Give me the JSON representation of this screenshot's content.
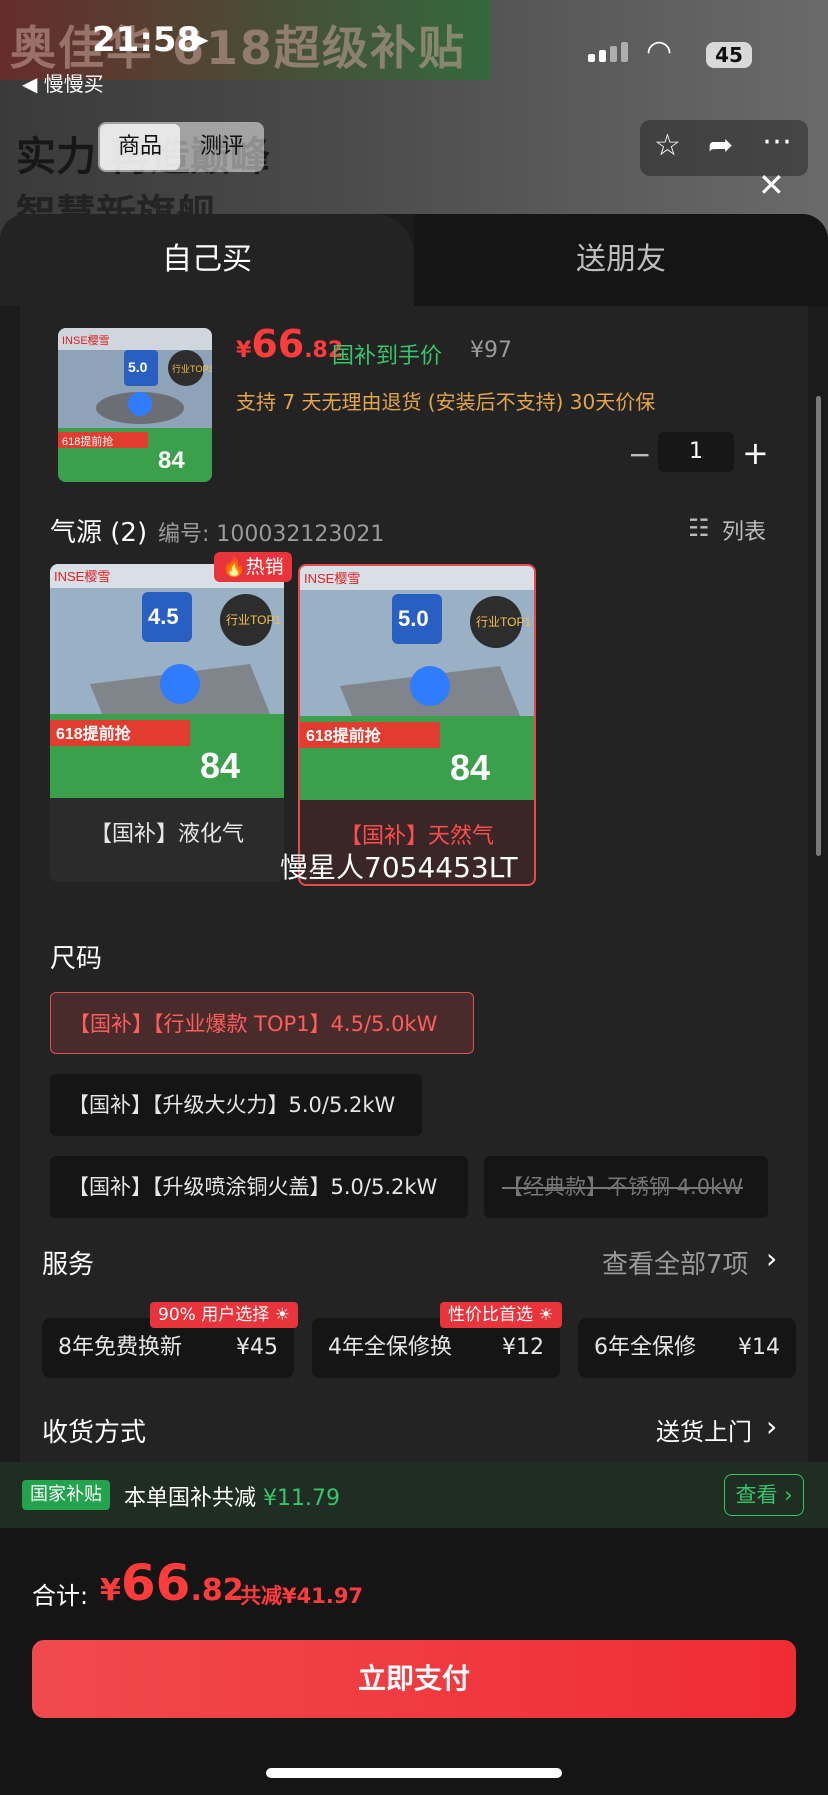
{
  "status_bar": {
    "time": "21:58",
    "back_app": "◀ 慢慢买",
    "battery": "45"
  },
  "background_page": {
    "banner_text": "奥佳华  618超级补贴",
    "slogan_line1": "实力 再造巅峰",
    "slogan_line2": "智慧新旗舰",
    "tab_goods": "商品",
    "tab_review": "测评"
  },
  "sheet": {
    "tabs": [
      {
        "label": "自己买",
        "active": true
      },
      {
        "label": "送朋友",
        "active": false
      }
    ],
    "product": {
      "price_currency": "¥",
      "price_int": "66",
      "price_dec": ".82",
      "subsidy_tag": "国补到手价",
      "original_price": "¥97",
      "policy": "支持 7 天无理由退货 (安装后不支持)  30天价保",
      "quantity": "1",
      "image": {
        "brand": "INSE樱雪",
        "power": "5.0",
        "badge": "行业TOP1",
        "promo": "618提前抢",
        "sale_price": "84"
      }
    },
    "gas_source": {
      "title": "气源 (2)",
      "sku_label": "编号: 100032123021",
      "list_label": "列表",
      "options": [
        {
          "label": "【国补】液化气",
          "badge": "热销",
          "power": "4.5",
          "selected": false
        },
        {
          "label": "【国补】天然气",
          "power": "5.0",
          "selected": true
        }
      ],
      "image_text": {
        "brand": "INSE樱雪",
        "badge": "行业TOP1",
        "promo": "618提前抢",
        "sale_price": "84"
      },
      "watermark": "慢星人7054453LT"
    },
    "size": {
      "title": "尺码",
      "options": [
        {
          "label": "【国补】【行业爆款 TOP1】4.5/5.0kW",
          "state": "selected"
        },
        {
          "label": "【国补】【升级大火力】5.0/5.2kW",
          "state": "normal"
        },
        {
          "label": "【国补】【升级喷涂铜火盖】5.0/5.2kW",
          "state": "normal"
        },
        {
          "label": "【经典款】不锈钢 4.0kW",
          "state": "disabled"
        }
      ]
    },
    "service": {
      "title": "服务",
      "view_all": "查看全部7项",
      "items": [
        {
          "name": "8年免费换新",
          "price": "¥45",
          "badge": "90% 用户选择 ☀"
        },
        {
          "name": "4年全保修换",
          "price": "¥12",
          "badge": "性价比首选 ☀"
        },
        {
          "name": "6年全保修",
          "price": "¥14"
        }
      ]
    },
    "shipping": {
      "title": "收货方式",
      "value": "送货上门"
    }
  },
  "subsidy_bar": {
    "badge": "国家补贴",
    "text": "本单国补共减",
    "amount": "¥11.79",
    "view": "查看"
  },
  "checkout": {
    "total_label": "合计:",
    "currency": "¥",
    "total_int": "66",
    "total_dec": ".82",
    "discount": "共减¥41.97",
    "pay_button": "立即支付"
  },
  "colors": {
    "accent_red": "#ff3b3b",
    "subsidy_green": "#37c46b",
    "policy_orange": "#e2a54b"
  }
}
